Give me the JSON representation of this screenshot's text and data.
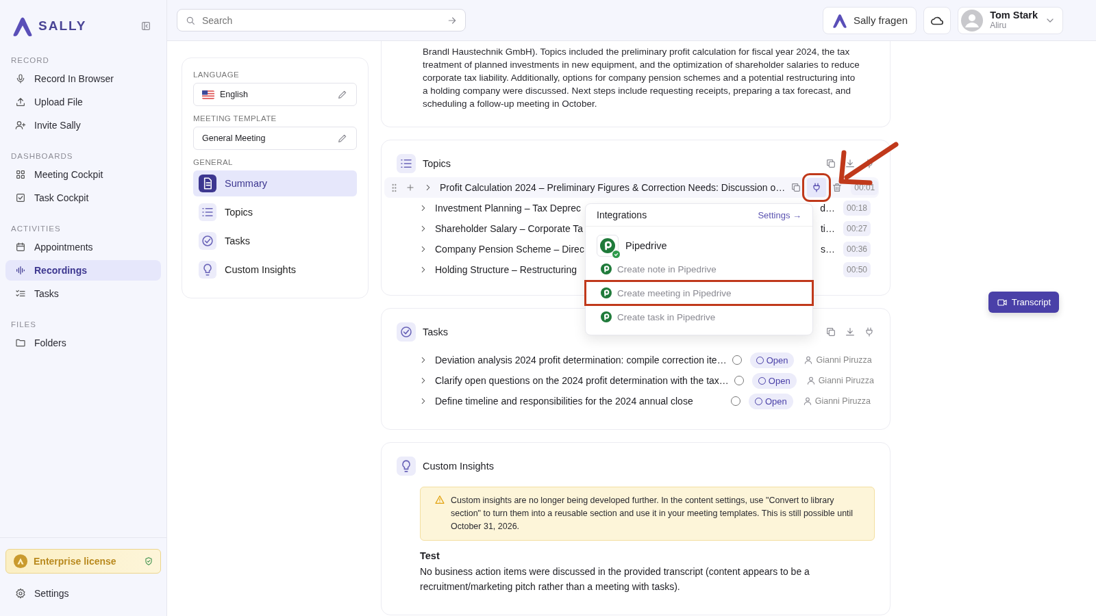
{
  "sidebar": {
    "brand": "SALLY",
    "sections": [
      {
        "heading": "RECORD",
        "items": [
          {
            "label": "Record In Browser",
            "selected": false
          },
          {
            "label": "Upload File",
            "selected": false
          },
          {
            "label": "Invite Sally",
            "selected": false
          }
        ]
      },
      {
        "heading": "DASHBOARDS",
        "items": [
          {
            "label": "Meeting Cockpit",
            "selected": false
          },
          {
            "label": "Task Cockpit",
            "selected": false
          }
        ]
      },
      {
        "heading": "ACTIVITIES",
        "items": [
          {
            "label": "Appointments",
            "selected": false
          },
          {
            "label": "Recordings",
            "selected": true
          },
          {
            "label": "Tasks",
            "selected": false
          }
        ]
      },
      {
        "heading": "FILES",
        "items": [
          {
            "label": "Folders",
            "selected": false
          }
        ]
      }
    ],
    "license": "Enterprise license",
    "settings": "Settings"
  },
  "header": {
    "search": {
      "placeholder": "Search"
    },
    "ask_button": "Sally fragen",
    "user": {
      "name": "Tom Stark",
      "org": "Aliru"
    }
  },
  "settings_panel": {
    "language_label": "LANGUAGE",
    "language": "English",
    "template_label": "MEETING TEMPLATE",
    "template": "General Meeting",
    "general_label": "GENERAL",
    "sections": [
      {
        "label": "Summary",
        "selected": true
      },
      {
        "label": "Topics",
        "selected": false
      },
      {
        "label": "Tasks",
        "selected": false
      },
      {
        "label": "Custom Insights",
        "selected": false
      }
    ]
  },
  "summary": {
    "lines": [
      "Brandl Haustechnik GmbH). Topics included the preliminary profit calculation for fiscal year 2024, the tax",
      "treatment of planned investments in new equipment, and the optimization of shareholder salaries to reduce",
      "corporate tax liability. Additionally, options for company pension schemes and a potential restructuring into",
      "a holding company were discussed. Next steps include requesting receipts, preparing a tax forecast, and",
      "scheduling a follow-up meeting in October."
    ]
  },
  "topics": {
    "title": "Topics",
    "rows": [
      {
        "title": "Profit Calculation 2024 – Preliminary Figures & Correction Needs: Discussion o…",
        "tail": "",
        "time": "00:01",
        "hovered": true
      },
      {
        "title": "Investment Planning – Tax Deprec",
        "tail": "d…",
        "time": "00:18",
        "hovered": false
      },
      {
        "title": "Shareholder Salary – Corporate Ta",
        "tail": "ti…",
        "time": "00:27",
        "hovered": false
      },
      {
        "title": "Company Pension Scheme – Direc",
        "tail": "s…",
        "time": "00:36",
        "hovered": false
      },
      {
        "title": "Holding Structure – Restructuring",
        "tail": "",
        "time": "00:50",
        "hovered": false
      }
    ]
  },
  "integrations_menu": {
    "title": "Integrations",
    "settings_link": "Settings →",
    "app": "Pipedrive",
    "connected": true,
    "actions": [
      {
        "label": "Create note in Pipedrive",
        "highlighted": false
      },
      {
        "label": "Create meeting in Pipedrive",
        "highlighted": true
      },
      {
        "label": "Create task in Pipedrive",
        "highlighted": false
      }
    ]
  },
  "tasks": {
    "title": "Tasks",
    "rows": [
      {
        "title": "Deviation analysis 2024 profit determination: compile correction ite…",
        "done": false,
        "status": "Open",
        "assignee": "Gianni Piruzza"
      },
      {
        "title": "Clarify open questions on the 2024 profit determination with the tax…",
        "done": false,
        "status": "Open",
        "assignee": "Gianni Piruzza"
      },
      {
        "title": "Define timeline and responsibilities for the 2024 annual close",
        "done": false,
        "status": "Open",
        "assignee": "Gianni Piruzza"
      }
    ]
  },
  "custom_insights": {
    "title": "Custom Insights",
    "notice": "Custom insights are no longer being developed further. In the content settings, use \"Convert to library section\" to turn them into a reusable section and use it in your meeting templates. This is still possible until October 31, 2026.",
    "insight_title": "Test",
    "insight_text": "No business action items were discussed in the provided transcript (content appears to be a recruitment/marketing pitch rather than a meeting with tasks)."
  },
  "transcript_button": "Transcript"
}
